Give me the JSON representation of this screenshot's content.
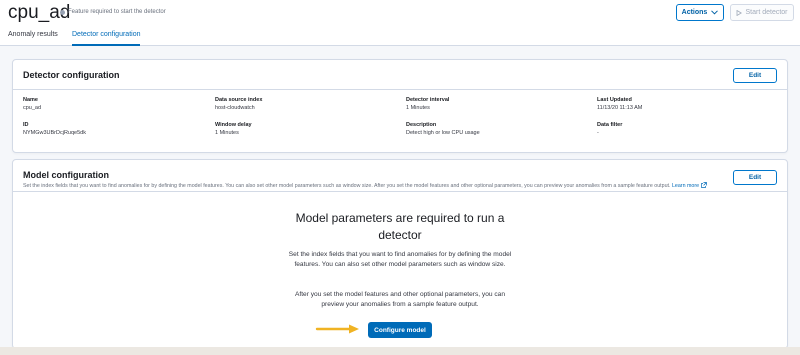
{
  "header": {
    "title": "cpu_ad",
    "status_text": "Feature required to start the detector",
    "actions_label": "Actions",
    "start_label": "Start detector"
  },
  "tabs": [
    {
      "label": "Anomaly results",
      "selected": false
    },
    {
      "label": "Detector configuration",
      "selected": true
    }
  ],
  "detector_config": {
    "title": "Detector configuration",
    "edit_label": "Edit",
    "fields": [
      {
        "label": "Name",
        "value": "cpu_ad"
      },
      {
        "label": "Data source index",
        "value": "host-cloudwatch"
      },
      {
        "label": "Detector interval",
        "value": "1 Minutes"
      },
      {
        "label": "Last Updated",
        "value": "11/13/20 11:13 AM"
      },
      {
        "label": "ID",
        "value": "NYMGw3UBrDcjRuqe5dk"
      },
      {
        "label": "Window delay",
        "value": "1 Minutes"
      },
      {
        "label": "Description",
        "value": "Detect high or low CPU usage"
      },
      {
        "label": "Data filter",
        "value": "-"
      }
    ]
  },
  "model_config": {
    "title": "Model configuration",
    "edit_label": "Edit",
    "description": "Set the index fields that you want to find anomalies for by defining the model features. You can also set other model parameters such as window size. After you set the model features and other optional parameters, you can preview your anomalies from a sample feature output.",
    "learn_more": "Learn more",
    "empty_title": "Model parameters are required to run a detector",
    "empty_body_1": "Set the index fields that you want to find anomalies for by defining the model features. You can also set other model parameters such as window size.",
    "empty_body_2": "After you set the model features and other optional parameters, you can preview your anomalies from a sample feature output.",
    "configure_label": "Configure model"
  },
  "colors": {
    "primary": "#006bb8",
    "annotation_arrow": "#f0b323",
    "border": "#d3dae6"
  },
  "icons": {
    "status": "status-dot-icon",
    "actions": "chevron-down-icon",
    "start": "play-icon",
    "learn_more": "external-link-icon",
    "annotation": "arrow-right-icon"
  }
}
